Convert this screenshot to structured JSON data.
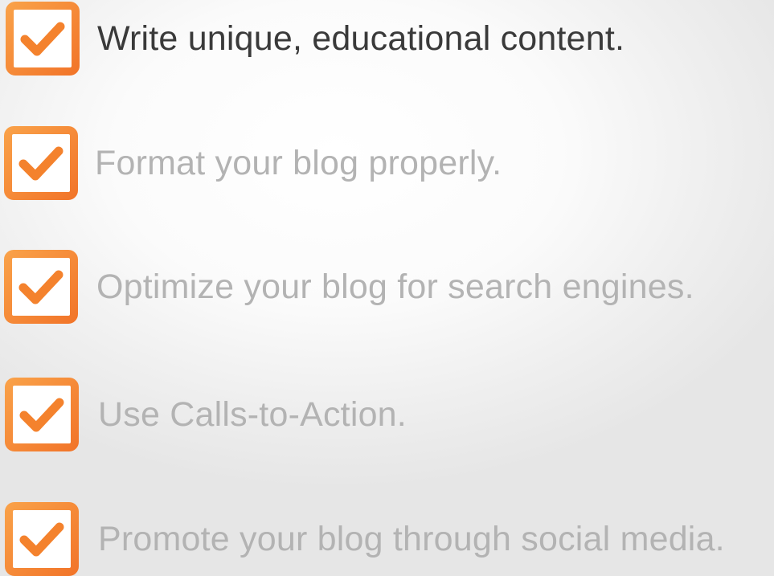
{
  "checklist": {
    "items": [
      {
        "label": "Write unique, educational content.",
        "checked": true,
        "active": true
      },
      {
        "label": "Format your blog properly.",
        "checked": true,
        "active": false
      },
      {
        "label": "Optimize your blog for search engines.",
        "checked": true,
        "active": false
      },
      {
        "label": "Use Calls-to-Action.",
        "checked": true,
        "active": false
      },
      {
        "label": "Promote your blog through social media.",
        "checked": true,
        "active": false
      }
    ]
  },
  "colors": {
    "checkbox_orange": "#f47c2a",
    "checkbox_orange_light": "#f9a04a",
    "active_text": "#3a3a3a",
    "inactive_text": "#b3b3b3",
    "background": "#f2f2f2"
  },
  "icons": {
    "checkbox": "checked-checkbox-icon"
  }
}
